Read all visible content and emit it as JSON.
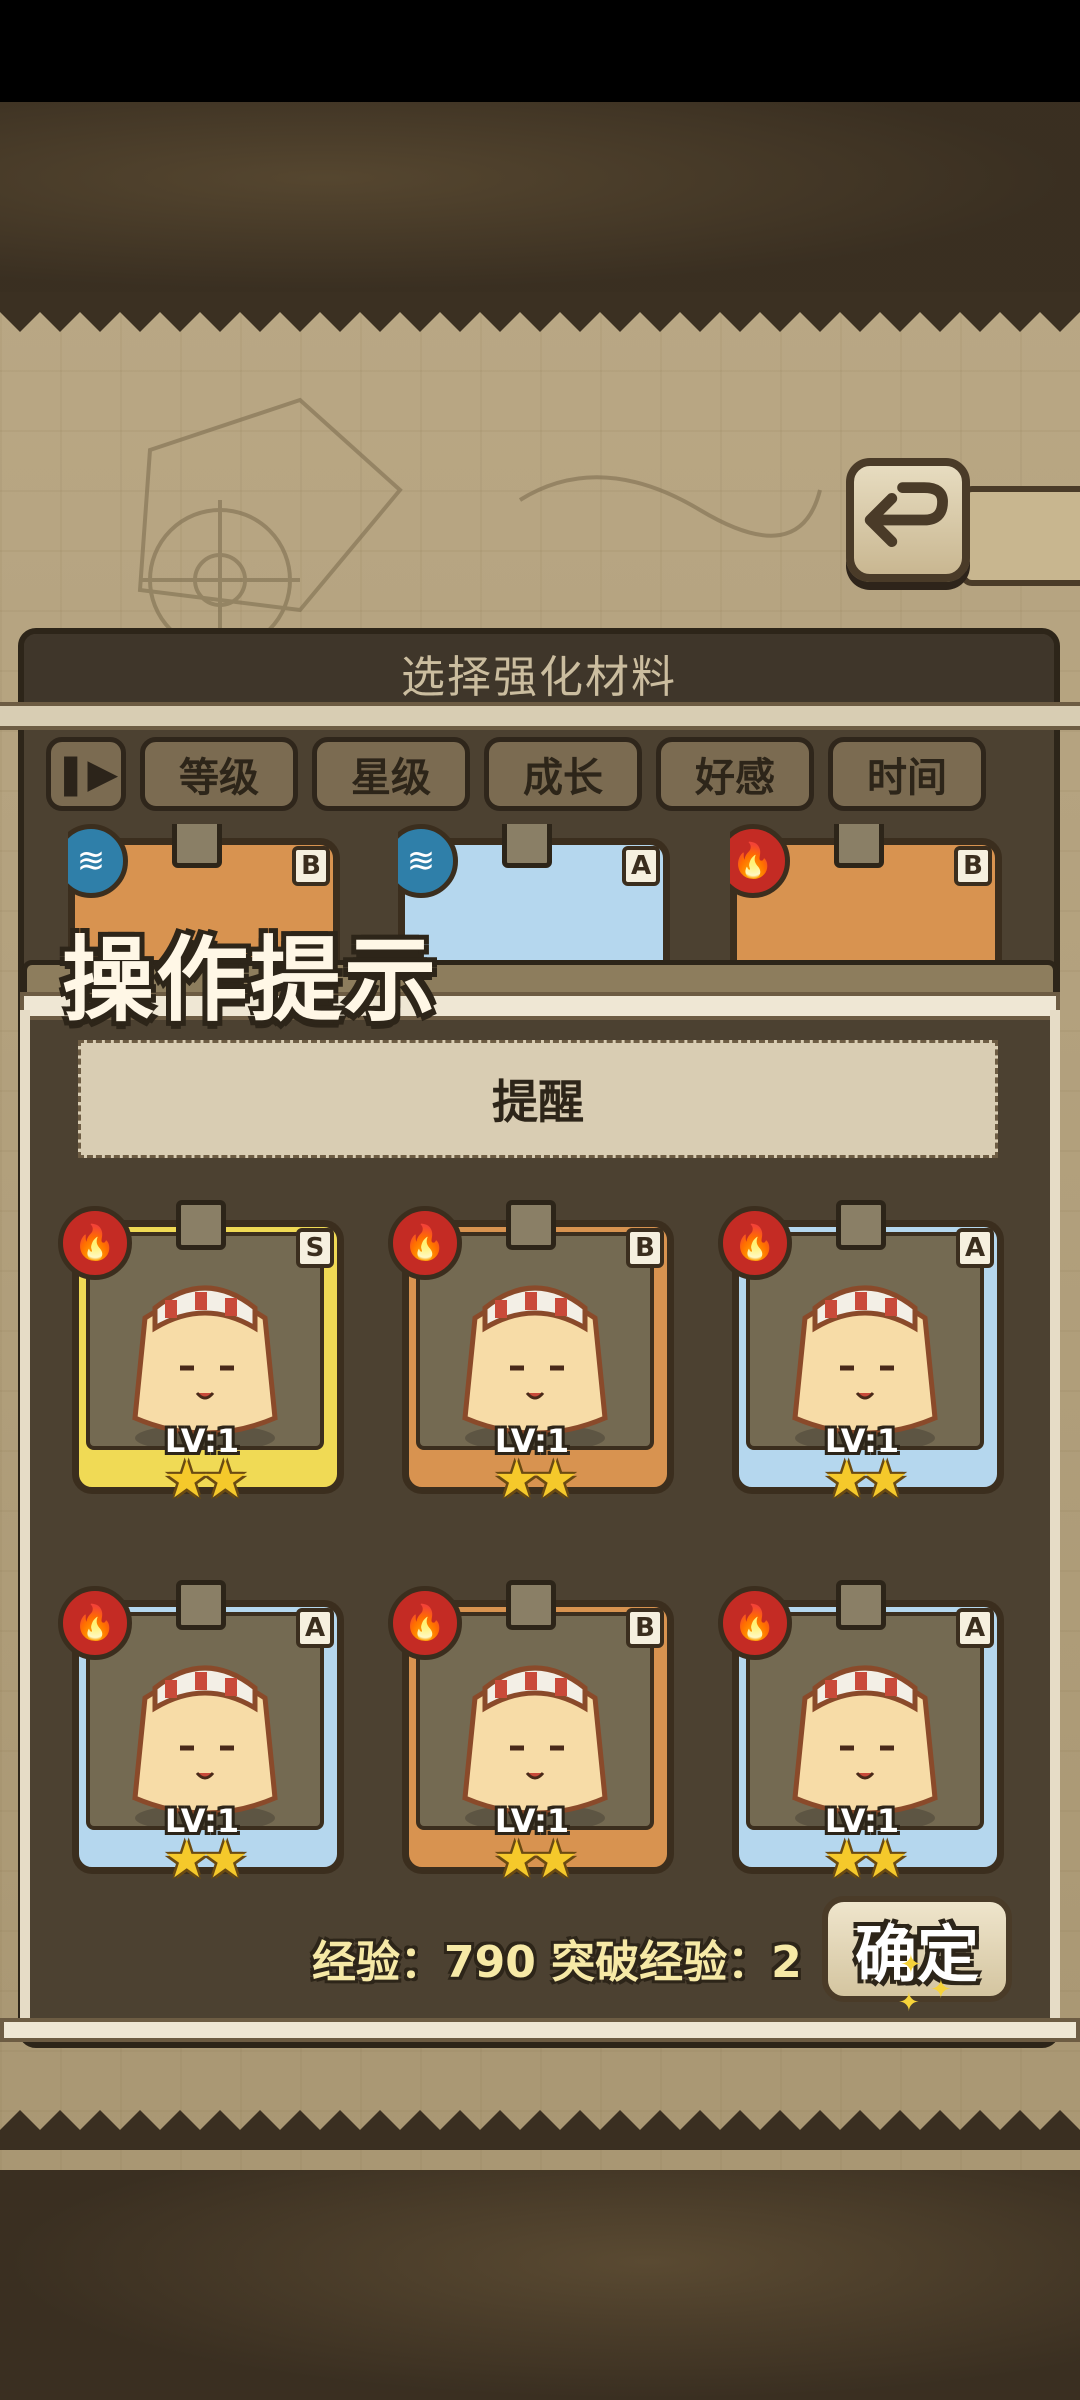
{
  "panel": {
    "title": "选择强化材料"
  },
  "filters": {
    "sort_icon": "sort-icon",
    "items": [
      "等级",
      "星级",
      "成长",
      "好感",
      "时间"
    ]
  },
  "dialog": {
    "title": "操作提示",
    "message": "提醒",
    "confirm_label": "确定"
  },
  "exp": {
    "label": "经验：790 突破经验：2"
  },
  "cards_top": [
    {
      "element": "water-icon",
      "rarity": "B",
      "frame": "bronze"
    },
    {
      "element": "water-icon",
      "rarity": "A",
      "frame": "blue"
    },
    {
      "element": "fire-icon",
      "rarity": "B",
      "frame": "bronze"
    }
  ],
  "cards": [
    {
      "element": "fire-icon",
      "rarity": "S",
      "frame": "gold",
      "level": "LV:1",
      "stars": "★★"
    },
    {
      "element": "fire-icon",
      "rarity": "B",
      "frame": "bronze",
      "level": "LV:1",
      "stars": "★★"
    },
    {
      "element": "fire-icon",
      "rarity": "A",
      "frame": "blue",
      "level": "LV:1",
      "stars": "★★"
    },
    {
      "element": "fire-icon",
      "rarity": "A",
      "frame": "blue",
      "level": "LV:1",
      "stars": "★★"
    },
    {
      "element": "fire-icon",
      "rarity": "B",
      "frame": "bronze",
      "level": "LV:1",
      "stars": "★★"
    },
    {
      "element": "fire-icon",
      "rarity": "A",
      "frame": "blue",
      "level": "LV:1",
      "stars": "★★"
    }
  ],
  "colors": {
    "gold_frame": "#f0da55",
    "bronze_frame": "#d89350",
    "blue_frame": "#b5d7ee",
    "fire": "#c42b24",
    "water": "#2f7fa9"
  }
}
